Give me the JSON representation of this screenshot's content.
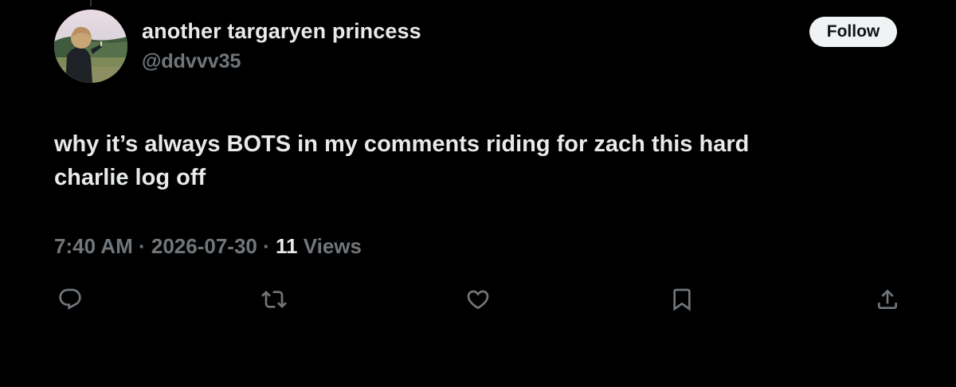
{
  "tweet": {
    "author": {
      "display_name": "another targaryen princess",
      "handle": "@ddvvv35",
      "avatar": "profile-photo"
    },
    "follow_label": "Follow",
    "text_lines": [
      "why it’s always BOTS in my comments riding for zach this hard",
      "charlie log off"
    ],
    "meta": {
      "time": "7:40 AM",
      "separator": "·",
      "date": "2026-07-30",
      "views_count": "11",
      "views_label": "Views"
    },
    "actions": [
      {
        "icon": "reply-icon"
      },
      {
        "icon": "retweet-icon"
      },
      {
        "icon": "like-icon"
      },
      {
        "icon": "bookmark-icon"
      },
      {
        "icon": "share-icon"
      }
    ]
  },
  "colors": {
    "background": "#000000",
    "primary_text": "#e7e9ea",
    "secondary_text": "#71767b",
    "follow_bg": "#eff3f4",
    "follow_text": "#0f1419"
  }
}
